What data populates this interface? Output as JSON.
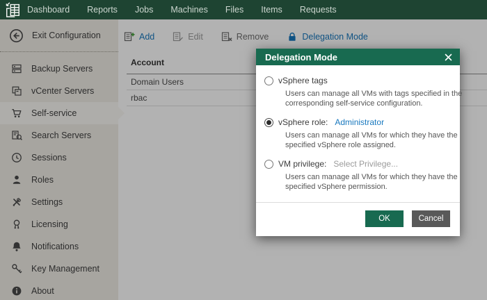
{
  "topnav": {
    "items": [
      "Dashboard",
      "Reports",
      "Jobs",
      "Machines",
      "Files",
      "Items",
      "Requests"
    ]
  },
  "sidebar": {
    "exit_label": "Exit Configuration",
    "items": [
      {
        "label": "Backup Servers",
        "icon": "backup-servers-icon",
        "selected": false
      },
      {
        "label": "vCenter Servers",
        "icon": "vcenter-servers-icon",
        "selected": false
      },
      {
        "label": "Self-service",
        "icon": "shopping-cart-icon",
        "selected": true
      },
      {
        "label": "Search Servers",
        "icon": "search-servers-icon",
        "selected": false
      },
      {
        "label": "Sessions",
        "icon": "clock-icon",
        "selected": false
      },
      {
        "label": "Roles",
        "icon": "person-icon",
        "selected": false
      },
      {
        "label": "Settings",
        "icon": "tools-icon",
        "selected": false
      },
      {
        "label": "Licensing",
        "icon": "medal-icon",
        "selected": false
      },
      {
        "label": "Notifications",
        "icon": "bell-icon",
        "selected": false
      },
      {
        "label": "Key Management",
        "icon": "key-icon",
        "selected": false
      },
      {
        "label": "About",
        "icon": "info-icon",
        "selected": false
      }
    ]
  },
  "toolbar": {
    "add": "Add",
    "edit": "Edit",
    "remove": "Remove",
    "delegation": "Delegation Mode"
  },
  "table": {
    "header": "Account",
    "rows": [
      {
        "account": "Domain Users"
      },
      {
        "account": "rbac"
      }
    ]
  },
  "dialog": {
    "title": "Delegation Mode",
    "options": [
      {
        "label": "vSphere tags",
        "selected": false,
        "desc": "Users can manage all VMs with tags specified in the corresponding self-service configuration."
      },
      {
        "label": "vSphere role:",
        "value": "Administrator",
        "selected": true,
        "desc": "Users can manage all VMs for which they have the specified vSphere role assigned."
      },
      {
        "label": "VM privilege:",
        "value": "Select Privilege...",
        "selected": false,
        "desc": "Users can manage all VMs for which they have the specified vSphere permission."
      }
    ],
    "ok": "OK",
    "cancel": "Cancel"
  },
  "colors": {
    "topbar_green": "#1e4432",
    "dialog_green": "#186a50",
    "link_blue": "#1878be",
    "plus_green": "#3f9c35",
    "cancel_gray": "#595959"
  }
}
